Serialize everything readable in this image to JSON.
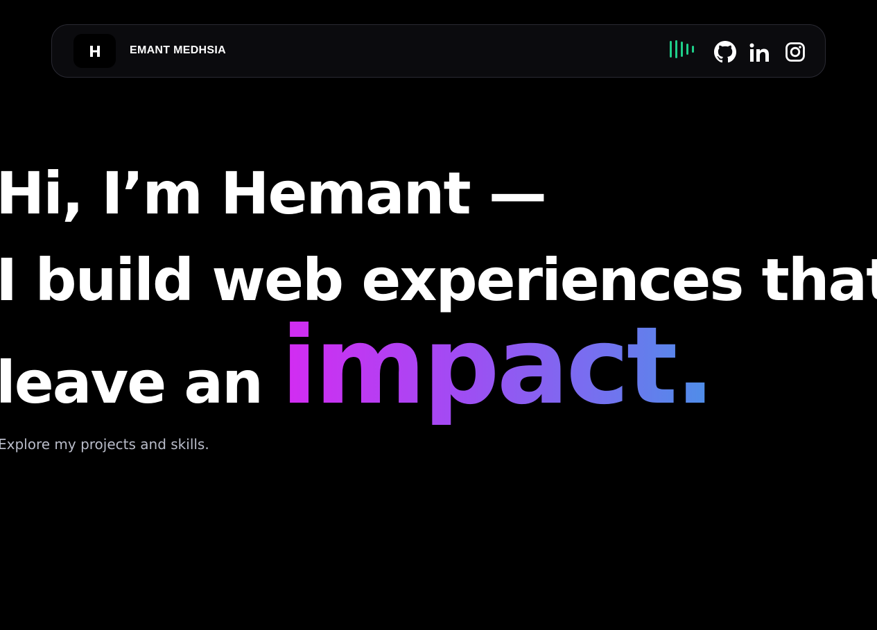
{
  "navbar": {
    "logo_letter": "H",
    "brand_name": "HEMANT MEDHSIA",
    "icons": [
      "audio-bars-icon",
      "github-icon",
      "linkedin-icon",
      "instagram-icon"
    ]
  },
  "hero": {
    "line1": "Hi, I’m Hemant —",
    "line2": "I build web experiences that",
    "line3_prefix": "leave an",
    "highlight": "impact.",
    "subtitle": "Explore my projects and skills."
  },
  "colors": {
    "background": "#000000",
    "navbar_bg": "#0b0b0e",
    "accent_green": "#1fcf8a",
    "gradient_start": "#d42bf2",
    "gradient_end": "#4d8fe8",
    "subtitle": "#b9bcc9"
  }
}
